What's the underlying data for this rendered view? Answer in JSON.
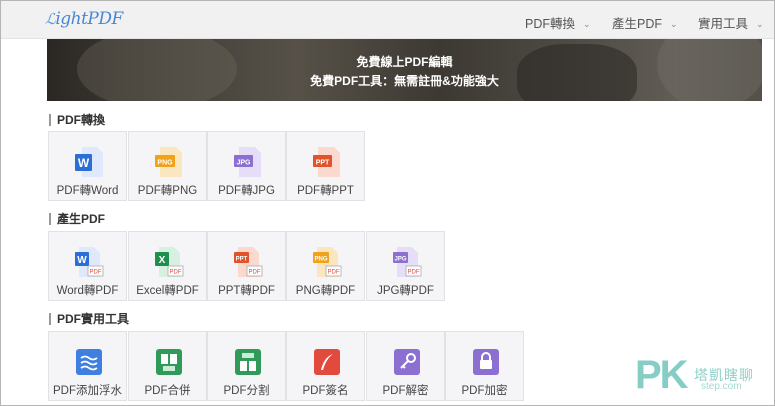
{
  "header": {
    "logo_text": "ightPDF",
    "nav": [
      {
        "label": "PDF轉換"
      },
      {
        "label": "產生PDF"
      },
      {
        "label": "實用工具"
      }
    ]
  },
  "banner": {
    "title": "免費線上PDF編輯",
    "subtitle": "免費PDF工具：無需註冊&功能強大"
  },
  "sections": [
    {
      "title": "PDF轉換",
      "tools": [
        {
          "label": "PDF轉Word",
          "icon": "word-icon",
          "color": "#2b6fd6"
        },
        {
          "label": "PDF轉PNG",
          "icon": "png-icon",
          "color": "#f0a21a"
        },
        {
          "label": "PDF轉JPG",
          "icon": "jpg-icon",
          "color": "#8b6fd1"
        },
        {
          "label": "PDF轉PPT",
          "icon": "ppt-icon",
          "color": "#e2522b"
        }
      ]
    },
    {
      "title": "產生PDF",
      "tools": [
        {
          "label": "Word轉PDF",
          "icon": "word-to-pdf-icon",
          "color": "#2b6fd6"
        },
        {
          "label": "Excel轉PDF",
          "icon": "excel-to-pdf-icon",
          "color": "#1f8f4e"
        },
        {
          "label": "PPT轉PDF",
          "icon": "ppt-to-pdf-icon",
          "color": "#e2522b"
        },
        {
          "label": "PNG轉PDF",
          "icon": "png-to-pdf-icon",
          "color": "#f0a21a"
        },
        {
          "label": "JPG轉PDF",
          "icon": "jpg-to-pdf-icon",
          "color": "#8b6fd1"
        }
      ]
    },
    {
      "title": "PDF實用工具",
      "tools": [
        {
          "label": "PDF添加浮水",
          "icon": "watermark-icon",
          "color": "#3f7fe0"
        },
        {
          "label": "PDF合併",
          "icon": "merge-icon",
          "color": "#2f9a5a"
        },
        {
          "label": "PDF分割",
          "icon": "split-icon",
          "color": "#2f9a5a"
        },
        {
          "label": "PDF簽名",
          "icon": "signature-icon",
          "color": "#e24a3d"
        },
        {
          "label": "PDF解密",
          "icon": "unlock-key-icon",
          "color": "#8b6fd1"
        },
        {
          "label": "PDF加密",
          "icon": "lock-icon",
          "color": "#8b6fd1"
        }
      ]
    }
  ],
  "watermark": {
    "mark": "PK",
    "text": "塔凱瞎聊",
    "small": "step.com"
  }
}
